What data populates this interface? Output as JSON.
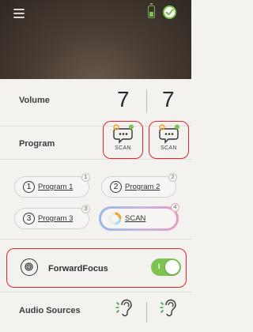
{
  "header": {
    "battery_color": "#7cc34f",
    "status_color": "#7cc34f",
    "battery_level": 0.45
  },
  "volume": {
    "label": "Volume",
    "left": "7",
    "right": "7"
  },
  "program": {
    "label": "Program",
    "left_scan_label": "SCAN",
    "right_scan_label": "SCAN"
  },
  "program_buttons": [
    {
      "number": "1",
      "label": "Program 1",
      "badge": "1"
    },
    {
      "number": "2",
      "label": "Program 2",
      "badge": "2"
    },
    {
      "number": "3",
      "label": "Program 3",
      "badge": "3"
    },
    {
      "label": "SCAN",
      "badge": "4"
    }
  ],
  "forward_focus": {
    "label": "ForwardFocus",
    "toggle_text": "I",
    "enabled": true
  },
  "audio_sources": {
    "label": "Audio Sources"
  },
  "colors": {
    "accent_green": "#7cc34f",
    "highlight_red": "#e0262b"
  }
}
